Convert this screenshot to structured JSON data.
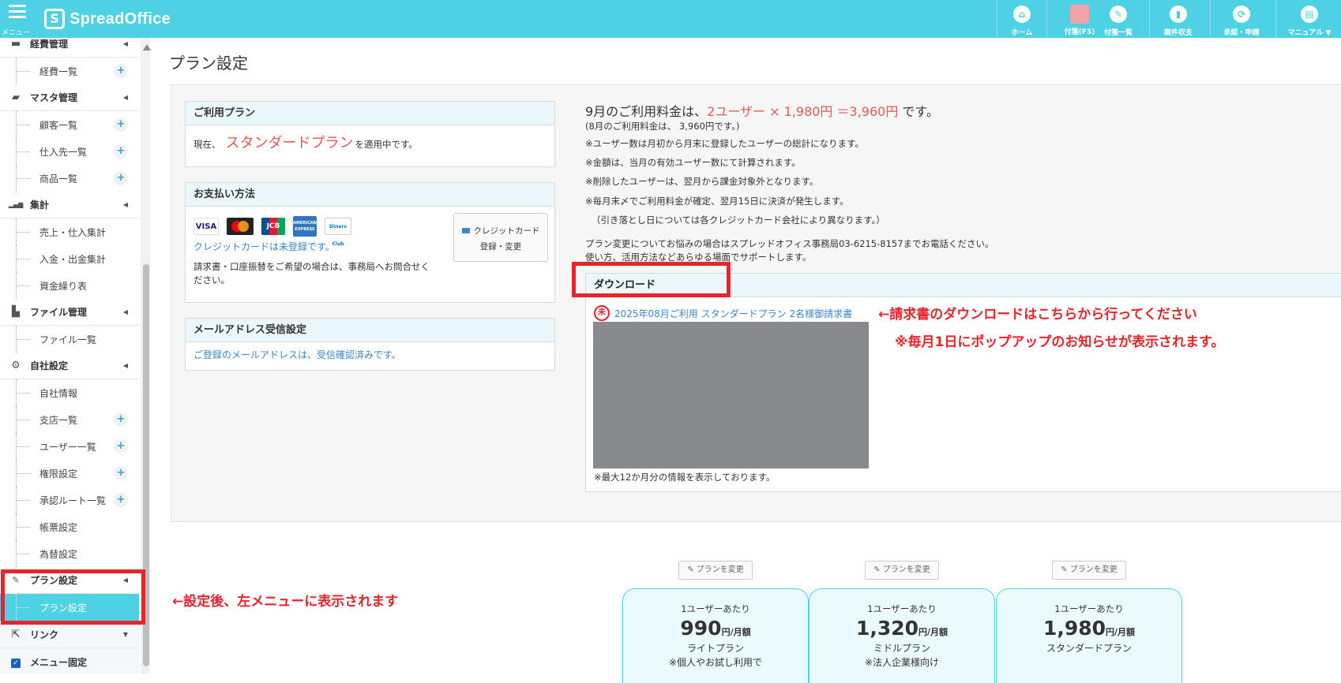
{
  "header": {
    "menu_label": "メニュー",
    "logo_text": "SpreadOffice",
    "nav": [
      {
        "label": "ホーム",
        "icon": "home-icon",
        "glyph": "⌂"
      },
      {
        "label": "付箋(F3)",
        "icon": "sticky-note-icon",
        "glyph": ""
      },
      {
        "label": "付箋一覧",
        "icon": "pin-icon",
        "glyph": "✎"
      },
      {
        "label": "案件収支",
        "icon": "bar-chart-icon",
        "glyph": "▮"
      },
      {
        "label": "承認・申請",
        "icon": "refresh-icon",
        "glyph": "⟳"
      },
      {
        "label": "マニュアル ▼",
        "icon": "book-icon",
        "glyph": "▤"
      }
    ]
  },
  "sidebar": {
    "sections": [
      {
        "label": "経費管理",
        "icon": "card-icon",
        "glyph": "▬",
        "items": [
          {
            "label": "経費一覧",
            "plus": true
          }
        ]
      },
      {
        "label": "マスタ管理",
        "icon": "folder-icon",
        "glyph": "▰",
        "items": [
          {
            "label": "顧客一覧",
            "plus": true
          },
          {
            "label": "仕入先一覧",
            "plus": true
          },
          {
            "label": "商品一覧",
            "plus": true
          }
        ]
      },
      {
        "label": "集計",
        "icon": "signal-icon",
        "glyph": "▂▄▆",
        "items": [
          {
            "label": "売上・仕入集計",
            "plus": false
          },
          {
            "label": "入金・出金集計",
            "plus": false
          },
          {
            "label": "資金繰り表",
            "plus": false
          }
        ]
      },
      {
        "label": "ファイル管理",
        "icon": "file-icon",
        "glyph": "▙",
        "items": [
          {
            "label": "ファイル一覧",
            "plus": false
          }
        ]
      },
      {
        "label": "自社設定",
        "icon": "gear-icon",
        "glyph": "⚙",
        "items": [
          {
            "label": "自社情報",
            "plus": false
          },
          {
            "label": "支店一覧",
            "plus": true
          },
          {
            "label": "ユーザー一覧",
            "plus": true
          },
          {
            "label": "権限設定",
            "plus": true
          },
          {
            "label": "承認ルート一覧",
            "plus": true
          },
          {
            "label": "帳票設定",
            "plus": false
          },
          {
            "label": "為替設定",
            "plus": false
          }
        ]
      },
      {
        "label": "プラン設定",
        "icon": "wrench-icon",
        "glyph": "🔧",
        "items": [
          {
            "label": "プラン設定",
            "plus": false,
            "active": true
          }
        ]
      }
    ],
    "link_label": "リンク",
    "menu_fixed_label": "メニュー固定",
    "menu_fixed_checked": true
  },
  "main": {
    "page_title": "プラン設定",
    "current_plan": {
      "title": "ご利用プラン",
      "prefix": "現在、",
      "plan_name": "スタンダードプラン",
      "suffix": "を適用中です。"
    },
    "payment": {
      "title": "お支払い方法",
      "cards": [
        "VISA",
        "MC",
        "JCB",
        "AMERICAN EXPRESS",
        "Diners Club"
      ],
      "unregistered": "クレジットカードは未登録です。",
      "note": "請求書・口座振替をご希望の場合は、事務局へお問合せください。",
      "cc_button_line1": "クレジットカード",
      "cc_button_line2": "登録・変更"
    },
    "mail": {
      "title": "メールアドレス受信設定",
      "status": "ご登録のメールアドレスは、受信確認済みです。"
    },
    "fee": {
      "prefix": "9月のご利用料金は、",
      "calc": "2ユーザー × 1,980円 ＝3,960円",
      "suffix": " です。",
      "prev": "(8月のご利用料金は、 3,960円です。)",
      "notes": [
        "※ユーザー数は月初から月末に登録したユーザーの総計になります。",
        "※金額は、当月の有効ユーザー数にて計算されます。",
        "※削除したユーザーは、翌月から課金対象外となります。",
        "※毎月末〆でご利用料金が確定、翌月15日に決済が発生します。",
        "（引き落とし日については各クレジットカード会社により異なります。）"
      ],
      "contact1": "プラン変更についてお悩みの場合はスプレッドオフィス事務局03-6215-8157までお電話ください。",
      "contact2": "使い方、活用方法などあらゆる場面でサポートします。"
    },
    "download": {
      "title": "ダウンロード",
      "badge": "未",
      "link": "2025年08月ご利用 スタンダードプラン 2名様御請求書",
      "footnote": "※最大12か月分の情報を表示しております。"
    },
    "annotations": {
      "download_hint": "←請求書のダウンロードはこちらから行ってください",
      "popup_hint": "※毎月1日にポップアップのお知らせが表示されます。",
      "menu_hint": "←設定後、左メニューに表示されます"
    },
    "plans": [
      {
        "change": "プランを変更",
        "per": "1ユーザーあたり",
        "price": "990",
        "unit": "円/月額",
        "name": "ライトプラン",
        "note": "※個人やお試し利用で"
      },
      {
        "change": "プランを変更",
        "per": "1ユーザーあたり",
        "price": "1,320",
        "unit": "円/月額",
        "name": "ミドルプラン",
        "note": "※法人企業様向け"
      },
      {
        "change": "プランを変更",
        "per": "1ユーザーあたり",
        "price": "1,980",
        "unit": "円/月額",
        "name": "スタンダードプラン",
        "note": ""
      }
    ]
  },
  "colors": {
    "accent": "#4dd2e3",
    "annotation_red": "#e8232a",
    "plan_red": "#e05a56",
    "link_blue": "#3a86c8"
  }
}
